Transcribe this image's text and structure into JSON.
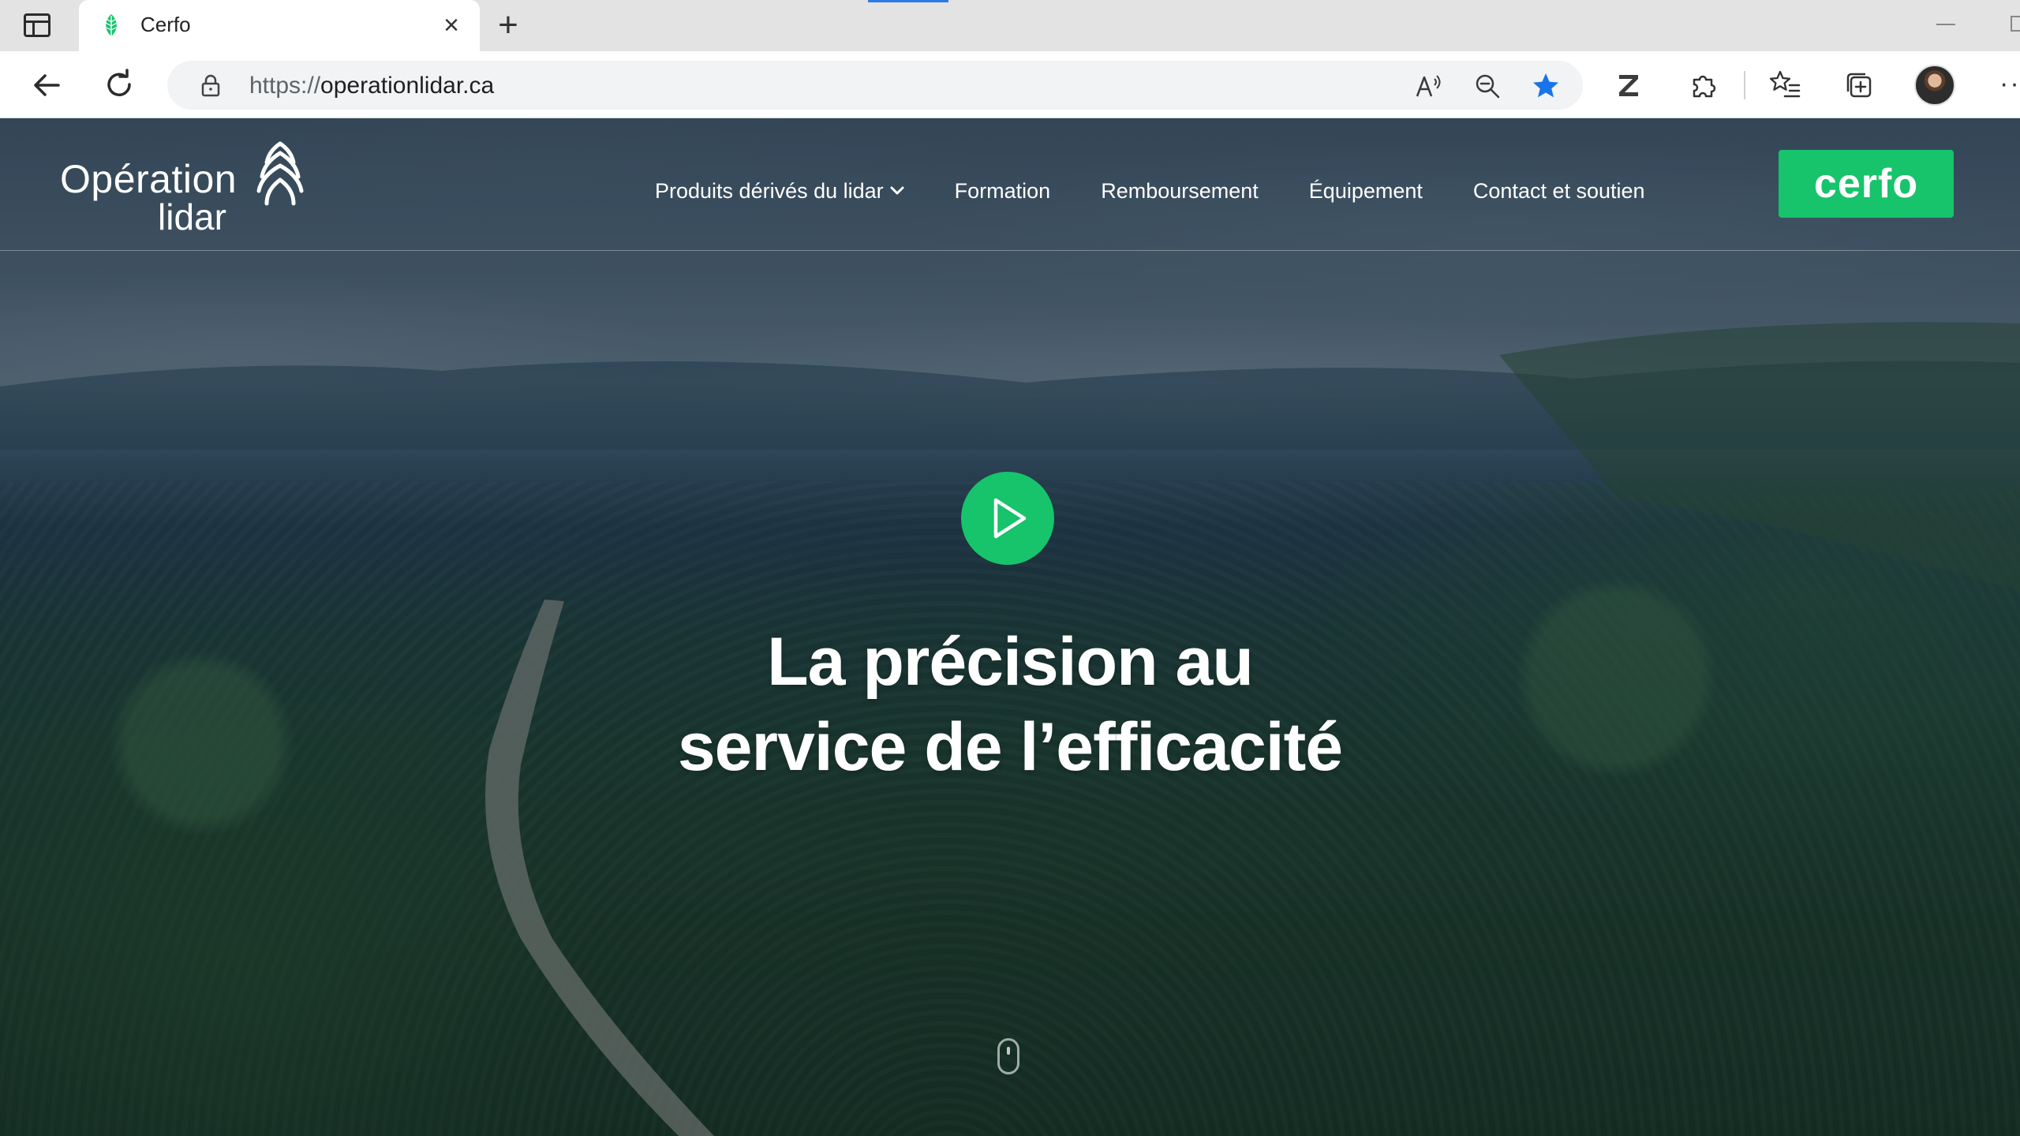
{
  "browser": {
    "tab": {
      "title": "Cerfo",
      "favicon": "cerfo-leaf-icon"
    },
    "address_bar": {
      "scheme": "https://",
      "host": "operationlidar.ca"
    },
    "icons": {
      "back": "back-arrow-icon",
      "reload": "reload-icon",
      "lock": "lock-icon",
      "read_aloud": "read-aloud-icon",
      "zoom": "zoom-out-icon",
      "favorite": "star-icon",
      "extension_z": "zotero-icon",
      "extensions": "puzzle-icon",
      "favorites": "favorites-list-icon",
      "collections": "collections-icon",
      "profile": "avatar",
      "more": "ellipsis-icon"
    },
    "more_label": "···",
    "colors": {
      "star": "#1a73e8"
    }
  },
  "site": {
    "logo": {
      "line1": "Opération",
      "line2": "lidar"
    },
    "nav": [
      {
        "label": "Produits dérivés du lidar",
        "has_dropdown": true
      },
      {
        "label": "Formation"
      },
      {
        "label": "Remboursement"
      },
      {
        "label": "Équipement"
      },
      {
        "label": "Contact et soutien"
      }
    ],
    "partner_button": "cerfo",
    "hero": {
      "title_line1": "La précision au",
      "title_line2": "service de l’efficacité"
    },
    "colors": {
      "accent": "#17c36b"
    }
  }
}
